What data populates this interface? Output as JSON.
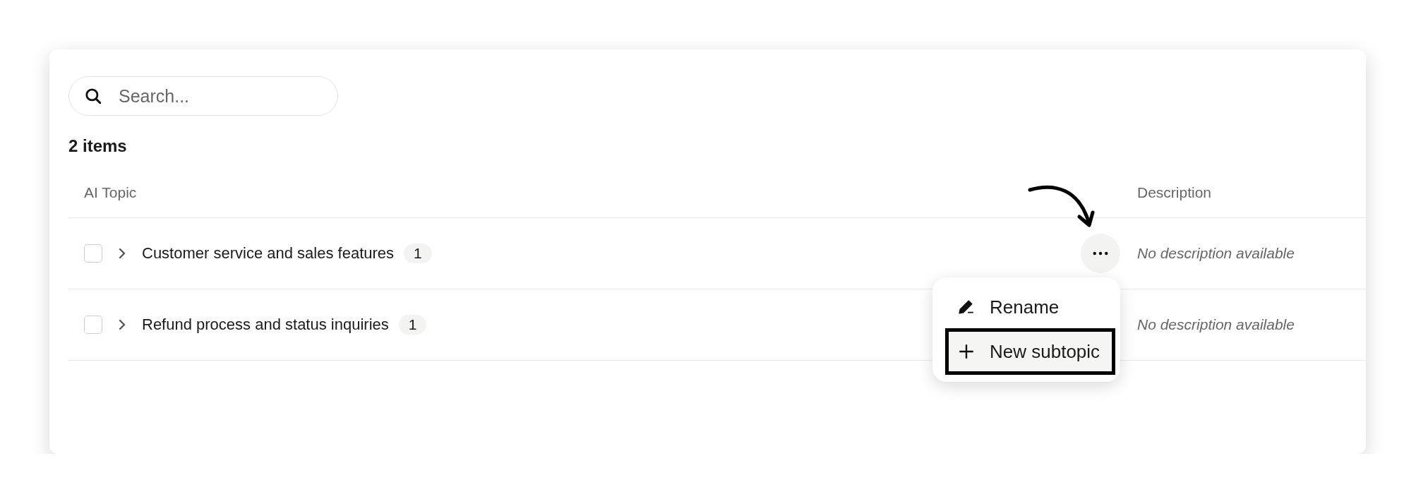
{
  "search": {
    "placeholder": "Search..."
  },
  "item_count": "2 items",
  "table": {
    "columns": [
      "AI Topic",
      "Description"
    ],
    "rows": [
      {
        "checked": false,
        "expanded": false,
        "title": "Customer service and sales features",
        "badge": "1",
        "description": "No description available",
        "actions_shown": true,
        "menu": [
          {
            "kind": "rename",
            "label": "Rename",
            "selected": false
          },
          {
            "kind": "add",
            "label": "New subtopic",
            "selected": true
          }
        ]
      },
      {
        "checked": false,
        "expanded": false,
        "title": "Refund process and status inquiries",
        "badge": "1",
        "description": "No description available",
        "actions_shown": false
      }
    ]
  }
}
